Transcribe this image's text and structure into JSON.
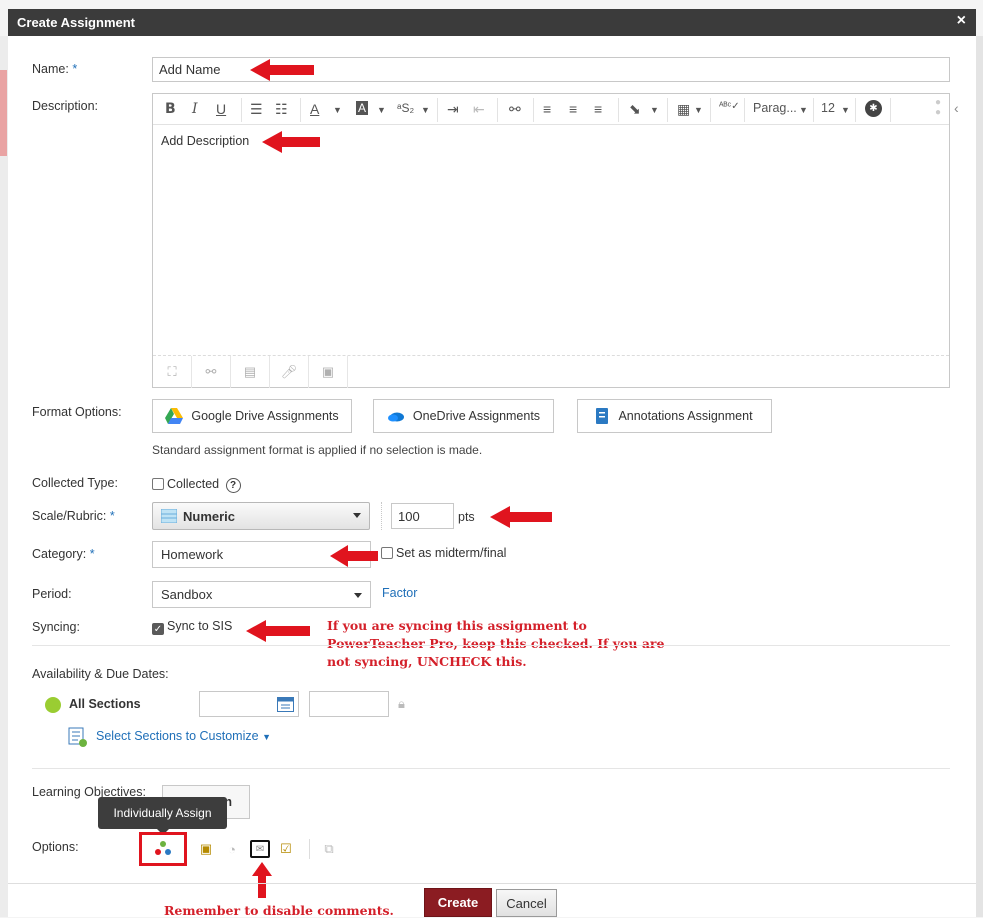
{
  "dialog": {
    "title": "Create Assignment",
    "close": "×"
  },
  "name": {
    "label": "Name:",
    "required": "*",
    "value": "Add Name"
  },
  "description": {
    "label": "Description:",
    "value": "Add Description",
    "toolbar": {
      "bold": "B",
      "italic": "I",
      "underline": "U",
      "paragraph": "Parag...",
      "font_size": "12"
    }
  },
  "format_options": {
    "label": "Format Options:",
    "google": "Google Drive Assignments",
    "onedrive": "OneDrive Assignments",
    "annotations": "Annotations Assignment",
    "helper": "Standard assignment format is applied if no selection is made."
  },
  "collected": {
    "label": "Collected Type:",
    "option": "Collected",
    "help": "?"
  },
  "scale": {
    "label": "Scale/Rubric:",
    "required": "*",
    "value": "Numeric",
    "points": "100",
    "unit": "pts"
  },
  "category": {
    "label": "Category:",
    "required": "*",
    "value": "Homework",
    "midterm": "Set as midterm/final"
  },
  "period": {
    "label": "Period:",
    "value": "Sandbox",
    "factor": "Factor"
  },
  "syncing": {
    "label": "Syncing:",
    "option": "Sync to SIS"
  },
  "sync_note": [
    "If you are syncing this assignment to",
    "PowerTeacher Pro, keep this checked. If you are",
    "not syncing, UNCHECK this."
  ],
  "availability": {
    "label": "Availability & Due Dates:",
    "all_sections": "All Sections",
    "customize": "Select Sections to Customize"
  },
  "objectives": {
    "label": "Learning Objectives:",
    "button_tail": "n"
  },
  "options": {
    "label": "Options:",
    "tooltip": "Individually Assign"
  },
  "comment_note": "Remember to disable comments.",
  "footer": {
    "create": "Create",
    "cancel": "Cancel"
  },
  "colors": {
    "accent": "#1f6fb8",
    "primary": "#8b1c22",
    "annotation": "#e0141e",
    "titlebar": "#3b3b3b"
  }
}
